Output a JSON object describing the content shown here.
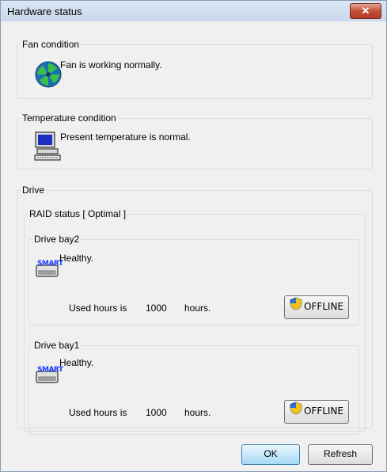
{
  "window": {
    "title": "Hardware status",
    "close_label": "✕"
  },
  "fan": {
    "legend": "Fan condition",
    "message": "Fan is working normally."
  },
  "temperature": {
    "legend": "Temperature condition",
    "message": "Present temperature is normal."
  },
  "drive": {
    "legend": "Drive",
    "raid_legend": "RAID status [ Optimal ]",
    "bays": [
      {
        "legend": "Drive bay2",
        "status": "Healthy.",
        "used_label": "Used hours is",
        "used_value": "1000",
        "used_unit": "hours.",
        "offline_label": "OFFLINE",
        "smart_label": "SMART"
      },
      {
        "legend": "Drive bay1",
        "status": "Healthy.",
        "used_label": "Used hours is",
        "used_value": "1000",
        "used_unit": "hours.",
        "offline_label": "OFFLINE",
        "smart_label": "SMART"
      }
    ]
  },
  "footer": {
    "ok_label": "OK",
    "refresh_label": "Refresh"
  }
}
